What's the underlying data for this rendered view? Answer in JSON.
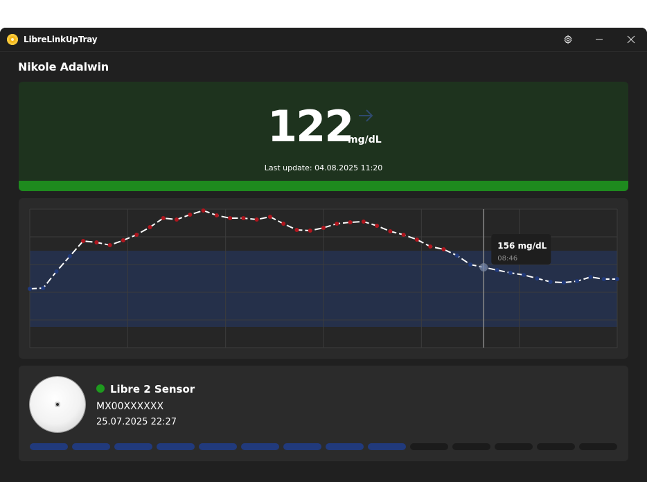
{
  "window": {
    "title": "LibreLinkUpTray"
  },
  "icons": {
    "app": "app-icon",
    "settings": "gear-icon",
    "minimize": "minimize-icon",
    "close": "close-icon",
    "trend": "arrow-right-icon",
    "sensor": "sensor-image"
  },
  "user": {
    "name": "Nikole Adalwin"
  },
  "glucose": {
    "value": "122",
    "unit": "mg/dL",
    "last_update": "Last update: 04.08.2025 11:20",
    "trend": "steady",
    "status_color": "#1e8a1e",
    "card_color": "#1e331e"
  },
  "chart_data": {
    "type": "line",
    "title": "",
    "xlabel": "",
    "ylabel": "",
    "unit": "mg/dL",
    "target_range": [
      70,
      180
    ],
    "ylim": [
      40,
      240
    ],
    "y": [
      125,
      126,
      150,
      172,
      194,
      192,
      188,
      195,
      203,
      214,
      227,
      225,
      232,
      238,
      231,
      227,
      227,
      225,
      229,
      219,
      210,
      209,
      213,
      219,
      221,
      222,
      216,
      208,
      203,
      196,
      186,
      182,
      173,
      160,
      156,
      152,
      148,
      145,
      140,
      135,
      134,
      136,
      142,
      139,
      139
    ],
    "high_threshold": 180,
    "colors": {
      "high": "#b0161e",
      "in_range": "#213a7c",
      "line": "#ffffff",
      "range_band": "#25304a"
    },
    "tooltip": {
      "value": "156 mg/dL",
      "time": "08:46",
      "index": 34
    }
  },
  "sensor": {
    "name": "Libre 2 Sensor",
    "serial": "MX00XXXXXX",
    "start_date": "25.07.2025 22:27",
    "status": "active",
    "lifetime_total_segments": 14,
    "lifetime_used_segments": 9
  }
}
